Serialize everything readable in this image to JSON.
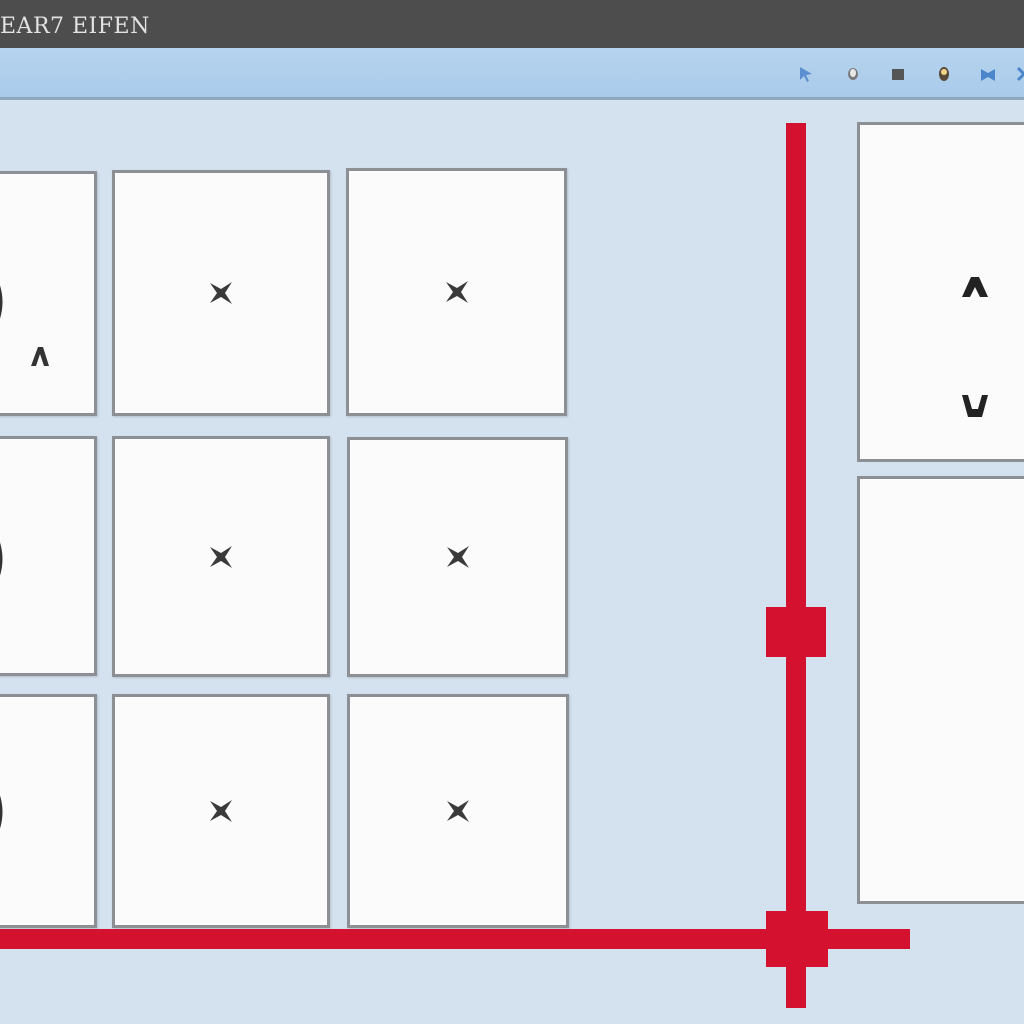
{
  "window": {
    "title": "EAR7 EIFEN"
  },
  "toolbar": {
    "icons": [
      "pointer-icon",
      "dot-icon",
      "square-icon",
      "pin-icon",
      "bookmark-icon",
      "close-icon"
    ]
  },
  "grid": {
    "rows": 3,
    "columns": [
      "partial",
      "full",
      "full"
    ],
    "mark_icon": "x-mark-icon"
  },
  "side_panel": {
    "top_icons": [
      "up-caret-icon",
      "down-caret-icon"
    ]
  },
  "colors": {
    "titlebar": "#4d4d4d",
    "toolbar": "#b0cfec",
    "canvas": "#d4e1ef",
    "accent_red": "#d4122f",
    "tile_border": "#8c9095"
  }
}
